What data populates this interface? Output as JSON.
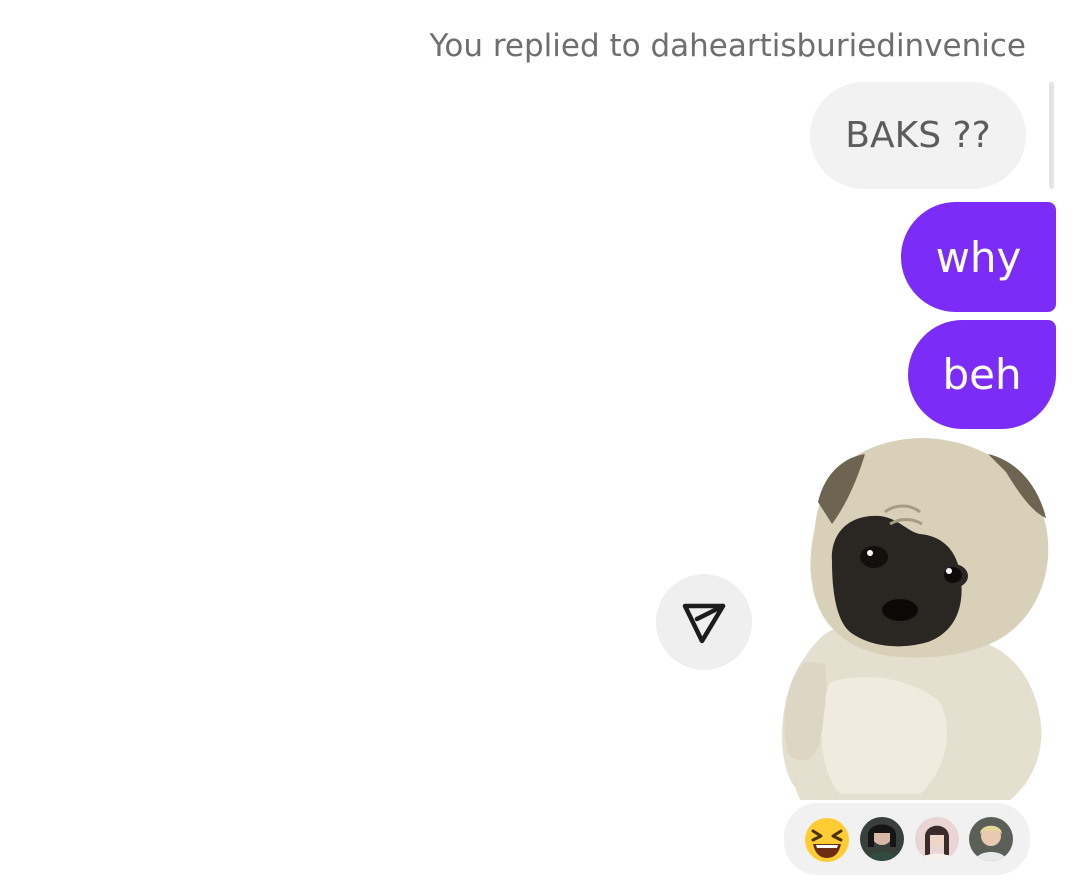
{
  "thread": {
    "reply_context": "You replied to daheartisburiedinvenice",
    "quoted_message": "BAKS ??",
    "messages": [
      {
        "text": "why"
      },
      {
        "text": "beh"
      }
    ],
    "sticker": {
      "description_icon": "pug-sticker"
    },
    "share_button": {
      "icon": "send-icon"
    },
    "reactions": {
      "emoji": "grinning-squinting-face",
      "avatars": [
        "reactor-avatar-1",
        "reactor-avatar-2",
        "reactor-avatar-3"
      ]
    }
  },
  "colors": {
    "sent_bubble": "#7b2cf6",
    "quoted_bubble": "#f2f2f2",
    "reply_label": "#6e6e6e"
  }
}
